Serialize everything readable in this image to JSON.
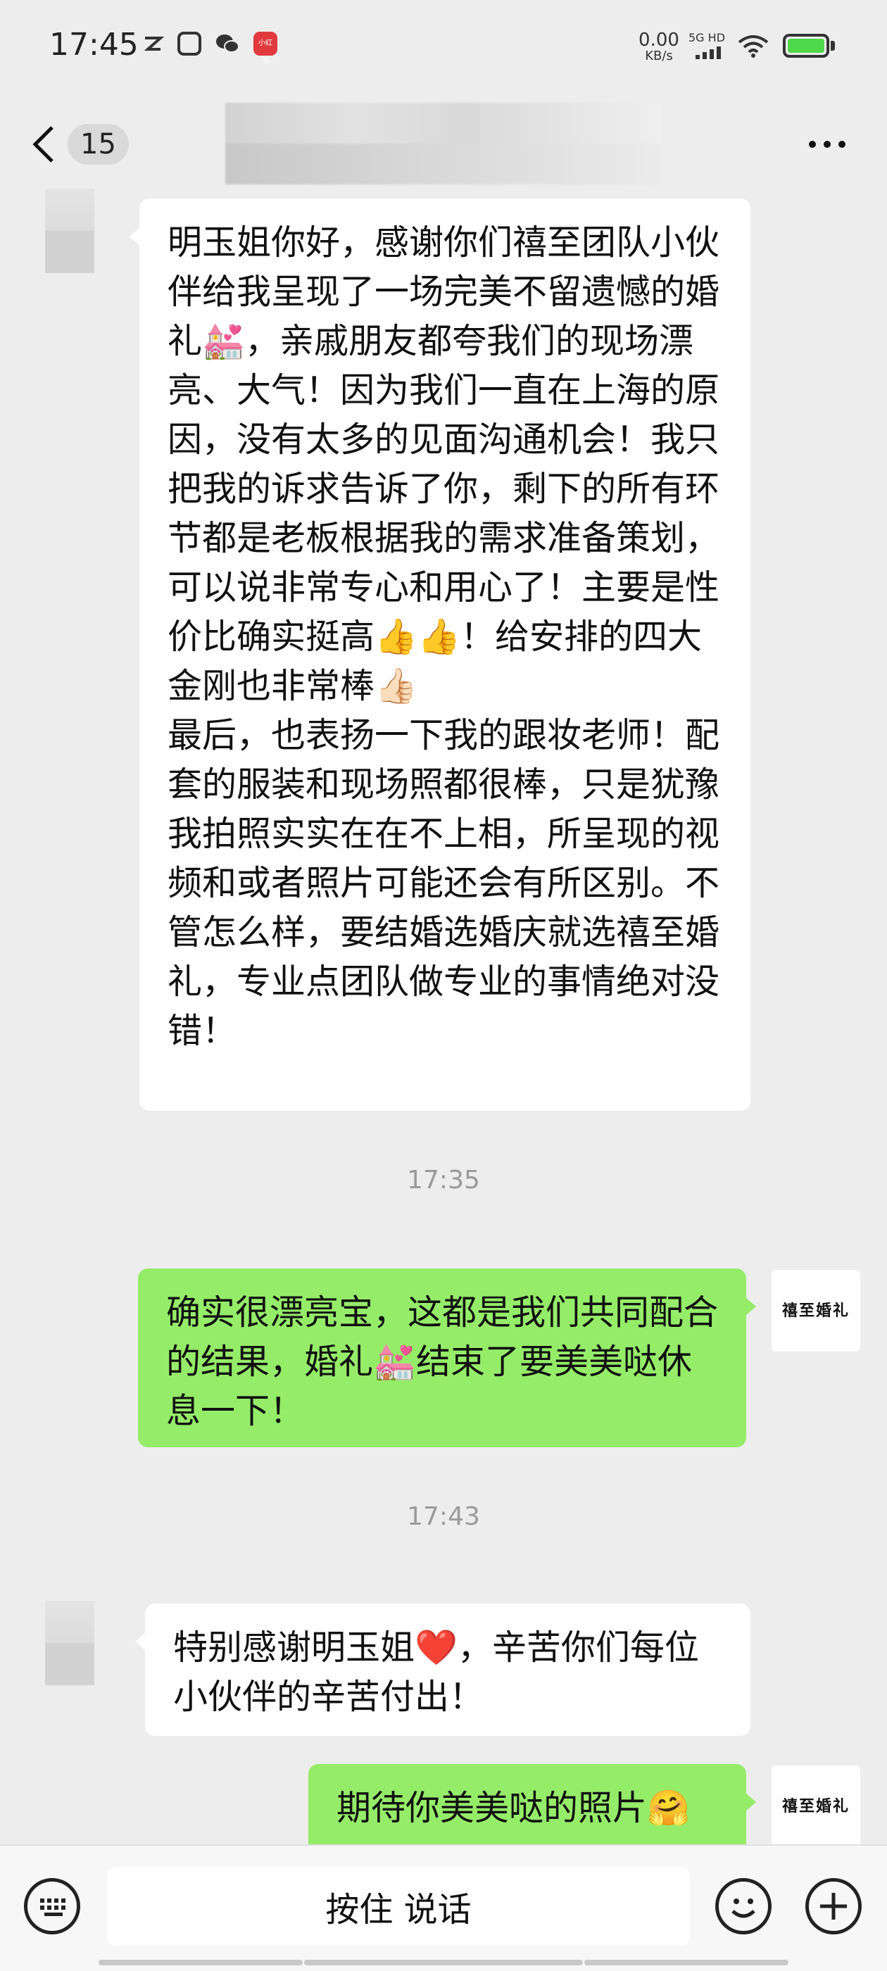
{
  "status_bar": {
    "time": "17:45",
    "net_speed_value": "0.00",
    "net_speed_unit": "KB/s",
    "network_label": "5G HD",
    "app_badge_label": "小红书",
    "battery_color": "#4ed84a"
  },
  "header": {
    "unread_count": "15"
  },
  "messages": [
    {
      "direction": "incoming",
      "text": "明玉姐你好，感谢你们禧至团队小伙伴给我呈现了一场完美不留遗憾的婚礼💒，亲戚朋友都夸我们的现场漂亮、大气！因为我们一直在上海的原因，没有太多的见面沟通机会！我只把我的诉求告诉了你，剩下的所有环节都是老板根据我的需求准备策划，可以说非常专心和用心了！主要是性价比确实挺高👍👍！给安排的四大金刚也非常棒👍🏻\n最后，也表扬一下我的跟妆老师！配套的服装和现场照都很棒，只是犹豫我拍照实实在在不上相，所呈现的视频和或者照片可能还会有所区别。不管怎么样，要结婚选婚庆就选禧至婚礼，专业点团队做专业的事情绝对没错！"
    },
    {
      "direction": "outgoing",
      "text": "确实很漂亮宝，这都是我们共同配合的结果，婚礼💒结束了要美美哒休息一下！"
    },
    {
      "direction": "incoming",
      "text": "特别感谢明玉姐❤️，辛苦你们每位小伙伴的辛苦付出！"
    },
    {
      "direction": "outgoing",
      "text": "期待你美美哒的照片🤗"
    }
  ],
  "timestamps": [
    "17:35",
    "17:43"
  ],
  "self_avatar": {
    "logo_text": "禧至婚礼"
  },
  "input_bar": {
    "voice_label": "按住 说话"
  },
  "colors": {
    "background": "#ededed",
    "incoming_bubble": "#ffffff",
    "outgoing_bubble": "#95ec69"
  }
}
